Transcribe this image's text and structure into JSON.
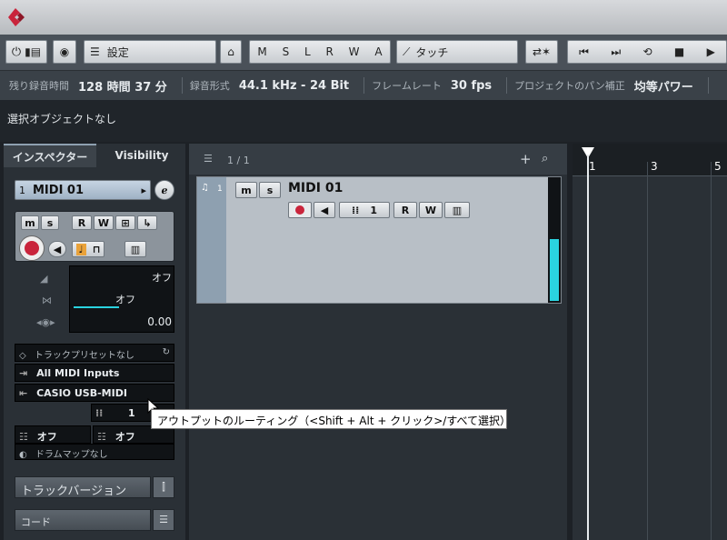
{
  "toolbar": {
    "preset": "設定",
    "modes": [
      "M",
      "S",
      "L",
      "R",
      "W",
      "A"
    ],
    "automation_mode": "タッチ"
  },
  "info": {
    "rec_time_label": "残り録音時間",
    "rec_time_value": "128 時間 37 分",
    "rec_format_label": "録音形式",
    "rec_format_value": "44.1 kHz - 24 Bit",
    "frame_rate_label": "フレームレート",
    "frame_rate_value": "30 fps",
    "pan_law_label": "プロジェクトのパン補正",
    "pan_law_value": "均等パワー"
  },
  "selection_text": "選択オブジェクトなし",
  "inspector": {
    "tab_inspector": "インスペクター",
    "tab_visibility": "Visibility",
    "track_number": "1",
    "track_name": "MIDI 01",
    "m": "m",
    "s": "s",
    "r": "R",
    "w": "W",
    "volume_value": "オフ",
    "pan_value": "オフ",
    "delay_value": "0.00",
    "preset": "トラックプリセットなし",
    "input": "All MIDI Inputs",
    "output": "CASIO USB-MIDI",
    "channel": "1",
    "bank": "オフ",
    "program": "オフ",
    "drum_map": "ドラムマップなし",
    "track_versions": "トラックバージョン",
    "chord": "コード"
  },
  "project": {
    "page": "1 / 1",
    "track_number": "1",
    "track_name": "MIDI 01",
    "m": "m",
    "s": "s",
    "r": "R",
    "w": "W",
    "channel": "1"
  },
  "ruler": {
    "marks": [
      "1",
      "3",
      "5"
    ]
  },
  "tooltip": "アウトプットのルーティング（<Shift + Alt + クリック>/すべて選択）",
  "colors": {
    "accent_red": "#c9243b",
    "meter_cyan": "#2ad3e0",
    "orange": "#e9a23a"
  }
}
